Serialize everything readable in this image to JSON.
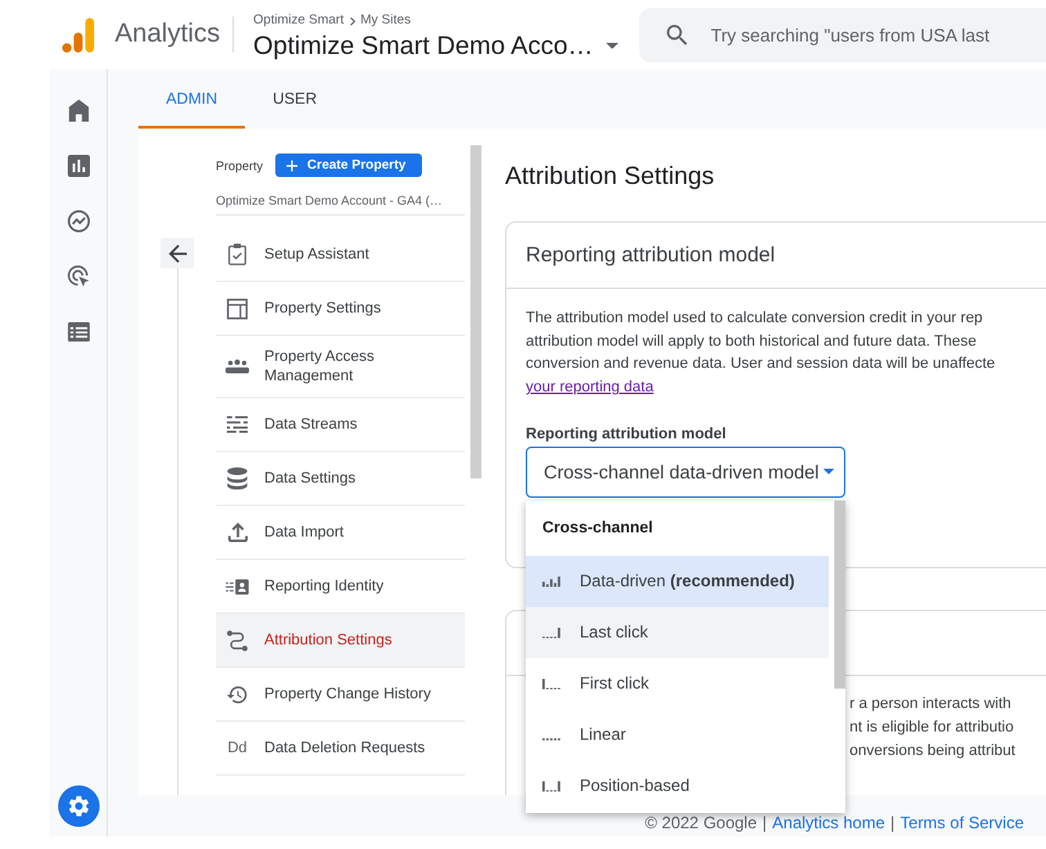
{
  "header": {
    "product": "Analytics",
    "breadcrumb": [
      "Optimize Smart",
      "My Sites"
    ],
    "account": "Optimize Smart Demo Acco…",
    "search": {
      "placeholder": "Try searching \"users from USA last"
    }
  },
  "nav_rail": {
    "items": [
      {
        "selected": false
      },
      {
        "selected": false
      },
      {
        "selected": false
      },
      {
        "selected": false
      },
      {
        "selected": false
      }
    ],
    "admin_button": {
      "selected": true
    }
  },
  "tabs": [
    {
      "label": "ADMIN",
      "selected": true
    },
    {
      "label": "USER",
      "selected": false
    }
  ],
  "property_panel": {
    "label": "Property",
    "create_button": "Create Property",
    "property_name": "Optimize Smart Demo Account - GA4 (…",
    "items": [
      {
        "label": "Setup Assistant",
        "selected": false
      },
      {
        "label": "Property Settings",
        "selected": false
      },
      {
        "label": "Property Access Management",
        "selected": false
      },
      {
        "label": "Data Streams",
        "selected": false
      },
      {
        "label": "Data Settings",
        "selected": false
      },
      {
        "label": "Data Import",
        "selected": false
      },
      {
        "label": "Reporting Identity",
        "selected": false
      },
      {
        "label": "Attribution Settings",
        "selected": true
      },
      {
        "label": "Property Change History",
        "selected": false
      },
      {
        "label": "Data Deletion Requests",
        "selected": false,
        "icon_text": "Dd"
      }
    ]
  },
  "content": {
    "title": "Attribution Settings",
    "card": {
      "title": "Reporting attribution model",
      "description_lines": [
        "The attribution model used to calculate conversion credit in your rep",
        "attribution model will apply to both historical and future data. These",
        "conversion and revenue data. User and session data will be unaffecte"
      ],
      "link": "your reporting data",
      "field_label": "Reporting attribution model",
      "select_value": "Cross-channel data-driven model",
      "menu": {
        "group": "Cross-channel",
        "options": [
          {
            "label": "Data-driven **(recommended)**",
            "selected": true,
            "hovered": false
          },
          {
            "label": "Last click",
            "selected": false,
            "hovered": true
          },
          {
            "label": "First click",
            "selected": false,
            "hovered": false
          },
          {
            "label": "Linear",
            "selected": false,
            "hovered": false
          },
          {
            "label": "Position-based",
            "selected": false,
            "hovered": false
          }
        ]
      }
    },
    "second_card": {
      "description_lines": [
        "r a person interacts with",
        "nt is eligible for attributio",
        "onversions being attribut"
      ]
    }
  },
  "footer": [
    {
      "kind": "text",
      "text": "© 2022 Google"
    },
    {
      "kind": "separator",
      "text": "|"
    },
    {
      "kind": "link",
      "text": "Analytics home"
    },
    {
      "kind": "separator",
      "text": "|"
    },
    {
      "kind": "link",
      "text": "Terms of Service"
    }
  ]
}
